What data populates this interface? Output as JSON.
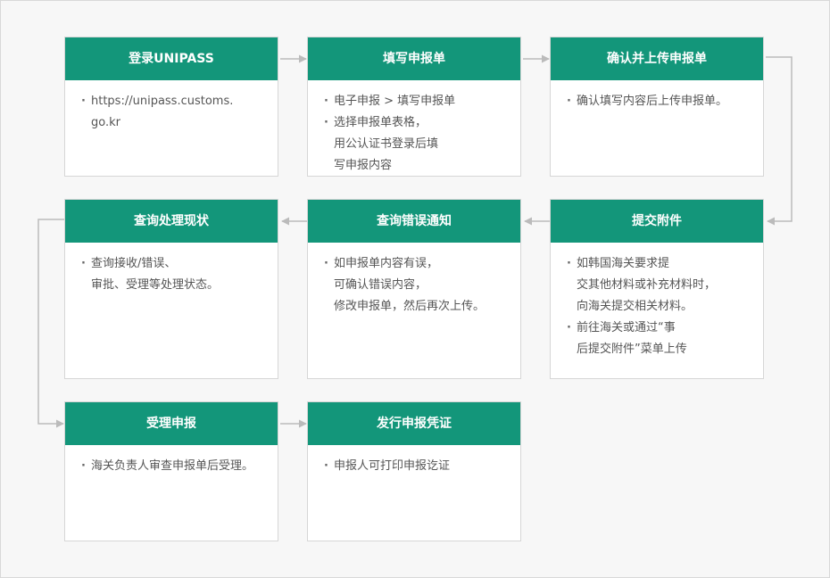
{
  "colors": {
    "header_bg": "#13967a",
    "header_text": "#ffffff",
    "arrow": "#bbbbbb",
    "body_text": "#555555"
  },
  "steps": [
    {
      "title": "登录UNIPASS",
      "items": [
        "https://unipass.customs.\ngo.kr"
      ]
    },
    {
      "title": "填写申报单",
      "items": [
        "电子申报 > 填写申报单",
        "选择申报单表格，\n用公认证书登录后填\n写申报内容"
      ]
    },
    {
      "title": "确认并上传申报单",
      "items": [
        "确认填写内容后上传申报单。"
      ]
    },
    {
      "title": "提交附件",
      "items": [
        "如韩国海关要求提\n交其他材料或补充材料时，\n向海关提交相关材料。",
        "前往海关或通过“事\n后提交附件”菜单上传"
      ]
    },
    {
      "title": "查询错误通知",
      "items": [
        "如申报单内容有误，\n可确认错误内容，\n修改申报单，然后再次上传。"
      ]
    },
    {
      "title": "查询处理现状",
      "items": [
        "查询接收/错误、\n审批、受理等处理状态。"
      ]
    },
    {
      "title": "受理申报",
      "items": [
        "海关负责人审查申报单后受理。"
      ]
    },
    {
      "title": "发行申报凭证",
      "items": [
        "申报人可打印申报讫证"
      ]
    }
  ]
}
